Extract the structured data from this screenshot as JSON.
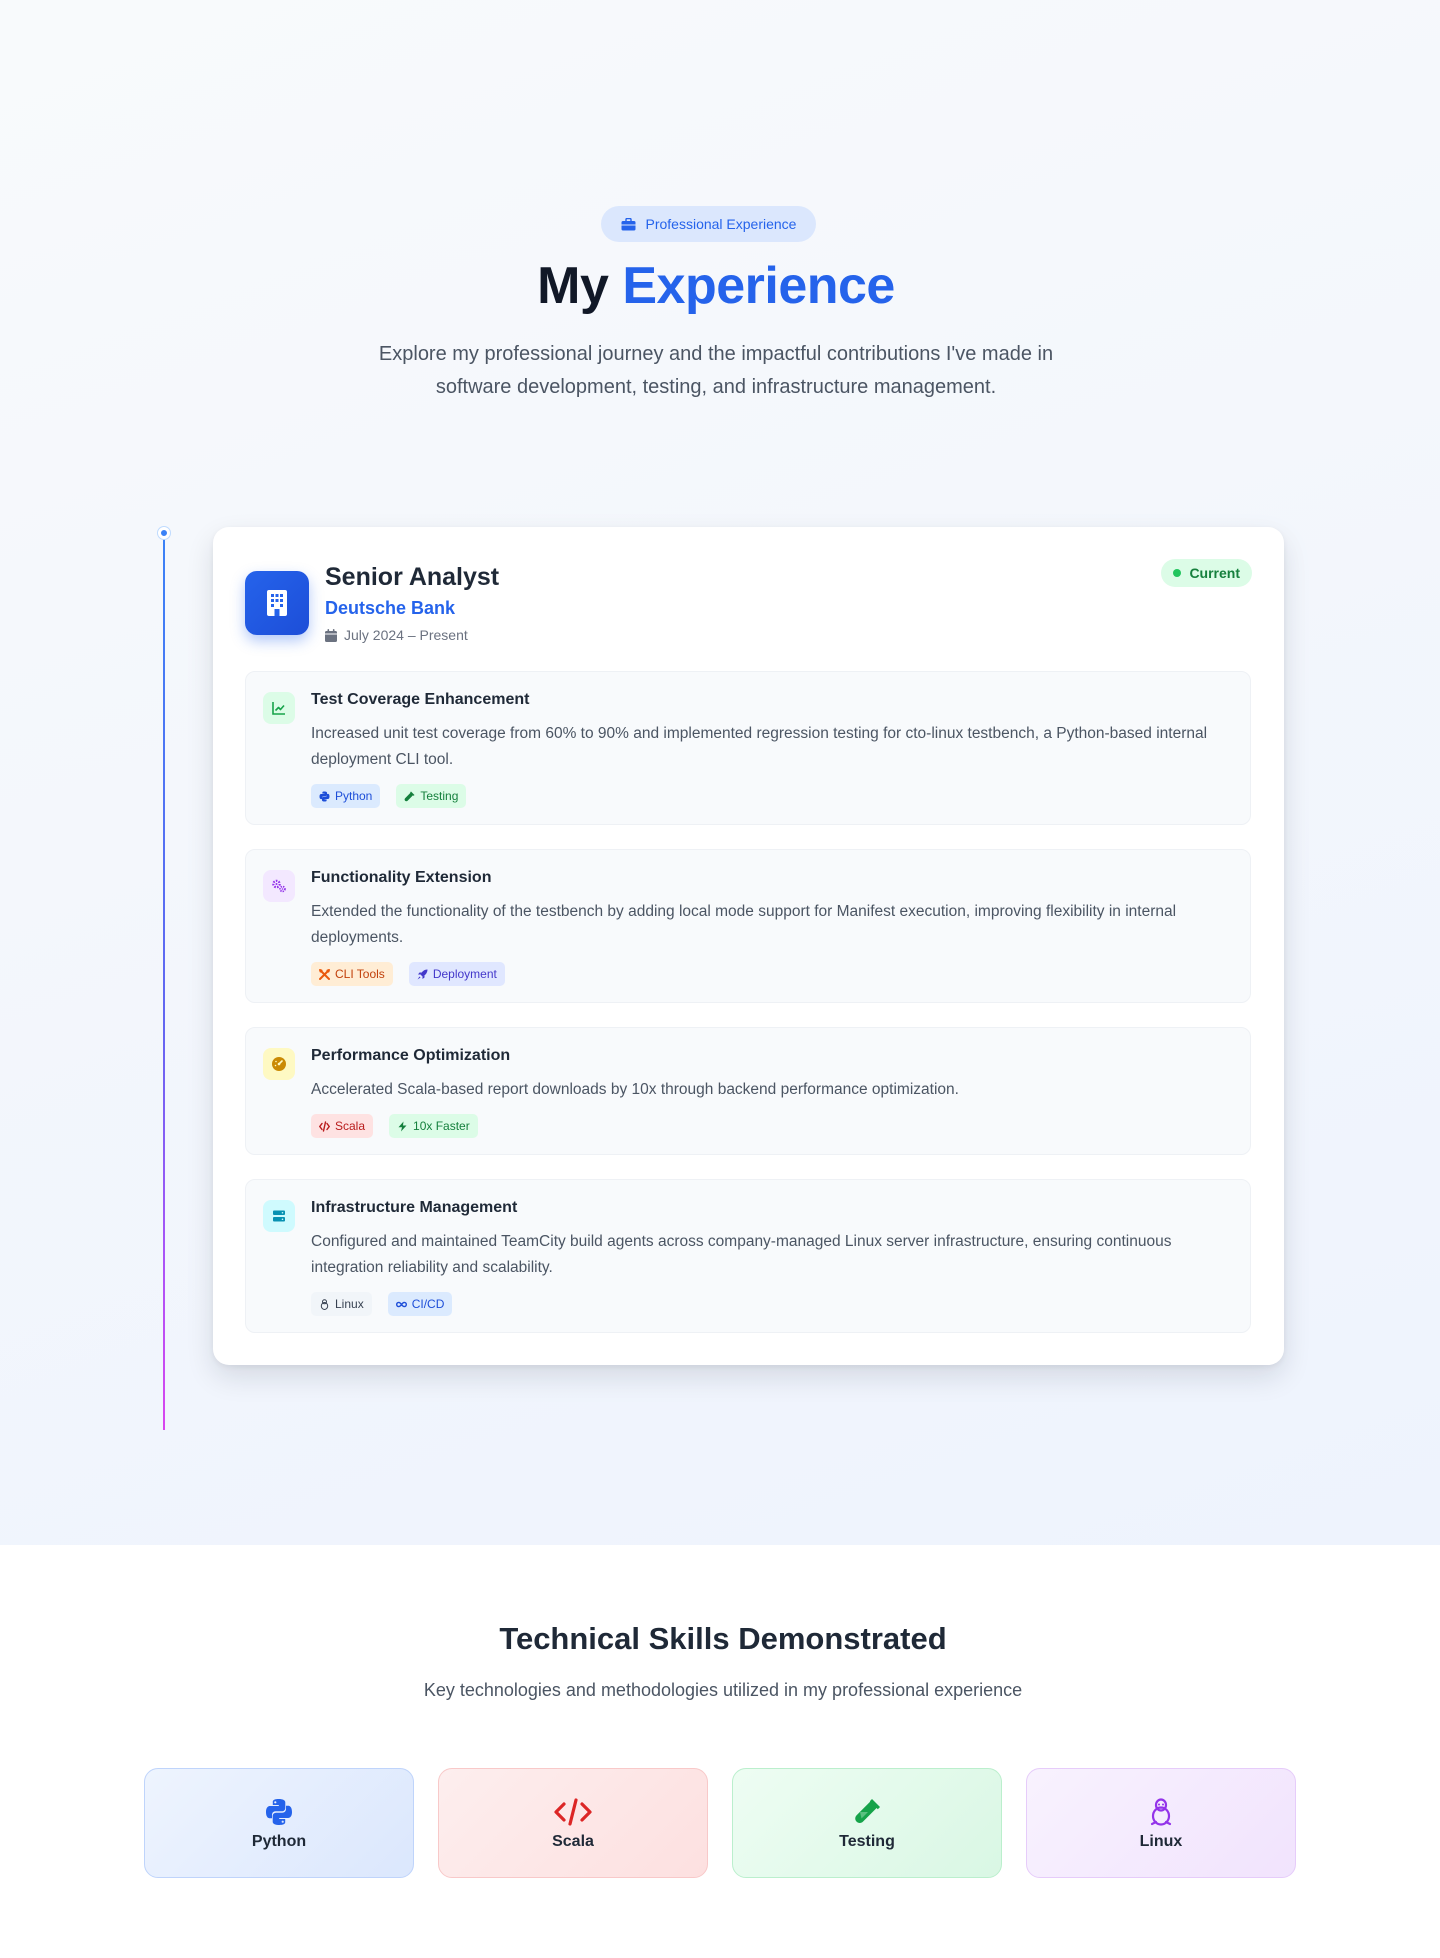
{
  "header": {
    "badge_label": "Professional Experience",
    "badge_icon": "briefcase-icon",
    "title_prefix": "My",
    "title_accent": "Experience",
    "subtitle": "Explore my professional journey and the impactful contributions I've made in software development, testing, and infrastructure management.",
    "accent_color": "#2563eb"
  },
  "job": {
    "title": "Senior Analyst",
    "company": "Deutsche Bank",
    "dates": "July 2024 – Present",
    "status": "Current",
    "logo_icon": "building-icon",
    "achievements": [
      {
        "title": "Test Coverage Enhancement",
        "description": "Increased unit test coverage from 60% to 90% and implemented regression testing for cto-linux testbench, a Python-based internal deployment CLI tool.",
        "icon": "chart-line-icon",
        "tags": [
          {
            "label": "Python",
            "icon": "python-icon"
          },
          {
            "label": "Testing",
            "icon": "vial-icon"
          }
        ]
      },
      {
        "title": "Functionality Extension",
        "description": "Extended the functionality of the testbench by adding local mode support for Manifest execution, improving flexibility in internal deployments.",
        "icon": "cogs-icon",
        "tags": [
          {
            "label": "CLI Tools",
            "icon": "tools-icon"
          },
          {
            "label": "Deployment",
            "icon": "rocket-icon"
          }
        ]
      },
      {
        "title": "Performance Optimization",
        "description": "Accelerated Scala-based report downloads by 10x through backend performance optimization.",
        "icon": "gauge-icon",
        "tags": [
          {
            "label": "Scala",
            "icon": "code-icon"
          },
          {
            "label": "10x Faster",
            "icon": "bolt-icon"
          }
        ]
      },
      {
        "title": "Infrastructure Management",
        "description": "Configured and maintained TeamCity build agents across company-managed Linux server infrastructure, ensuring continuous integration reliability and scalability.",
        "icon": "server-icon",
        "tags": [
          {
            "label": "Linux",
            "icon": "linux-icon"
          },
          {
            "label": "CI/CD",
            "icon": "infinity-icon"
          }
        ]
      }
    ]
  },
  "skills": {
    "title": "Technical Skills Demonstrated",
    "subtitle": "Key technologies and methodologies utilized in my professional experience",
    "items": [
      {
        "label": "Python",
        "icon": "python-icon",
        "color": "#2563eb"
      },
      {
        "label": "Scala",
        "icon": "code-icon",
        "color": "#dc2626"
      },
      {
        "label": "Testing",
        "icon": "vial-icon",
        "color": "#16a34a"
      },
      {
        "label": "Linux",
        "icon": "linux-icon",
        "color": "#9333ea"
      }
    ]
  }
}
